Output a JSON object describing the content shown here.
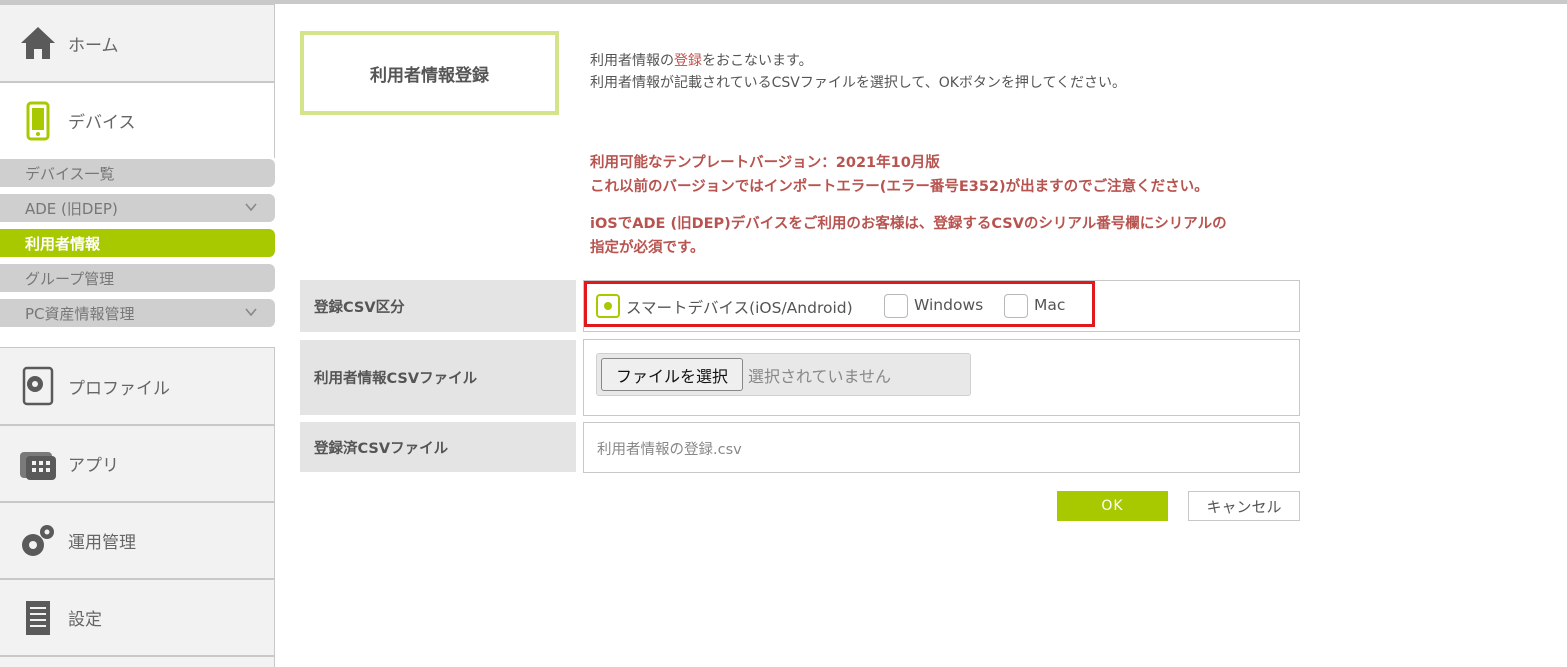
{
  "sidebar": {
    "home": "ホーム",
    "device": "デバイス",
    "sub_items": [
      {
        "label": "デバイス一覧"
      },
      {
        "label": "ADE (旧DEP)"
      },
      {
        "label": "利用者情報"
      },
      {
        "label": "グループ管理"
      },
      {
        "label": "PC資産情報管理"
      }
    ],
    "profile": "プロファイル",
    "app": "アプリ",
    "operation": "運用管理",
    "settings": "設定"
  },
  "main": {
    "title": "利用者情報登録",
    "desc_prefix": "利用者情報の",
    "desc_highlight": "登録",
    "desc_suffix": "をおこないます。",
    "desc_line2": "利用者情報が記載されているCSVファイルを選択して、OKボタンを押してください。",
    "warn_line1": "利用可能なテンプレートバージョン：2021年10月版",
    "warn_line2": "これ以前のバージョンではインポートエラー(エラー番号E352)が出ますのでご注意ください。",
    "warn_line3": "iOSでADE (旧DEP)デバイスをご利用のお客様は、登録するCSVのシリアル番号欄にシリアルの",
    "warn_line4": "指定が必須です。"
  },
  "form": {
    "csv_type_label": "登録CSV区分",
    "options": [
      {
        "label": "スマートデバイス(iOS/Android)",
        "checked": true
      },
      {
        "label": "Windows",
        "checked": false
      },
      {
        "label": "Mac",
        "checked": false
      }
    ],
    "file_label": "利用者情報CSVファイル",
    "file_button": "ファイルを選択",
    "file_status": "選択されていません",
    "registered_label": "登録済CSVファイル",
    "registered_value": "利用者情報の登録.csv"
  },
  "buttons": {
    "ok": "OK",
    "cancel": "キャンセル"
  },
  "colors": {
    "accent": "#a8c800",
    "warning": "#b85450",
    "highlight_border": "#e0191e"
  }
}
